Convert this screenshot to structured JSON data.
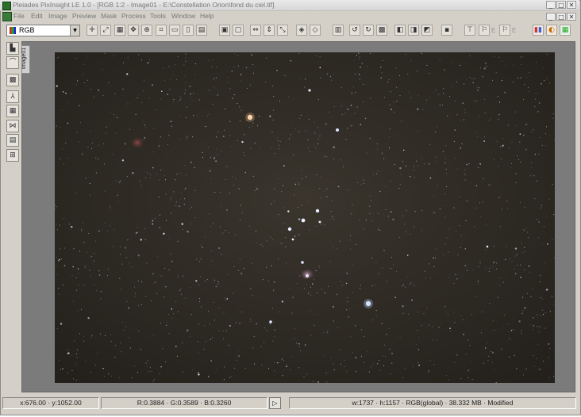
{
  "window": {
    "title": "Pleiades PixInsight LE 1.0 - [RGB 1:2 - Image01 - E:\\Constellation Orion\\fond du ciel.tif]",
    "controls": [
      "_",
      "□",
      "✕"
    ],
    "mdi_controls": [
      "_",
      "□",
      "✕"
    ]
  },
  "menu": {
    "items": [
      "File",
      "Edit",
      "Image",
      "Preview",
      "Mask",
      "Process",
      "Tools",
      "Window",
      "Help"
    ]
  },
  "toolbar": {
    "color_space": "RGB",
    "icons": [
      "crosshair-icon",
      "zoom-icon",
      "zoom-fit-icon",
      "move-icon",
      "pan-icon",
      "crop-icon",
      "select-icon",
      "page-icon",
      "document-icon",
      "frame-icon",
      "frame-icon-2",
      "fit-width-icon",
      "fit-height-icon",
      "fit-icon",
      "zoom-out-icon",
      "clipboard-icon",
      "rotate-left-icon",
      "rotate-right-icon",
      "flip-icon",
      "layer-icon",
      "layer-icon-2",
      "layer-icon-3",
      "stack-icon",
      "pin-icon",
      "flag-icon",
      "flag-icon-2",
      "histogram-icon",
      "color-balance-icon",
      "channels-icon"
    ],
    "flag_labels": [
      "E",
      "E"
    ]
  },
  "sidebar": {
    "tools": [
      "histogram-tool-icon",
      "curves-tool-icon",
      "noise-tool-icon",
      "star-tool-icon",
      "filter-tool-icon",
      "wavelet-tool-icon",
      "levels-tool-icon",
      "transform-tool-icon"
    ]
  },
  "image_tab": {
    "label": "Image01"
  },
  "status": {
    "coordinates": "x:676.00 · y:1052.00",
    "rgb_values": "R:0.3884 · G:0.3589 · B:0.3260",
    "image_info": "w:1737 · h:1157 · RGB(global) · 38.332 MB · Modified"
  }
}
